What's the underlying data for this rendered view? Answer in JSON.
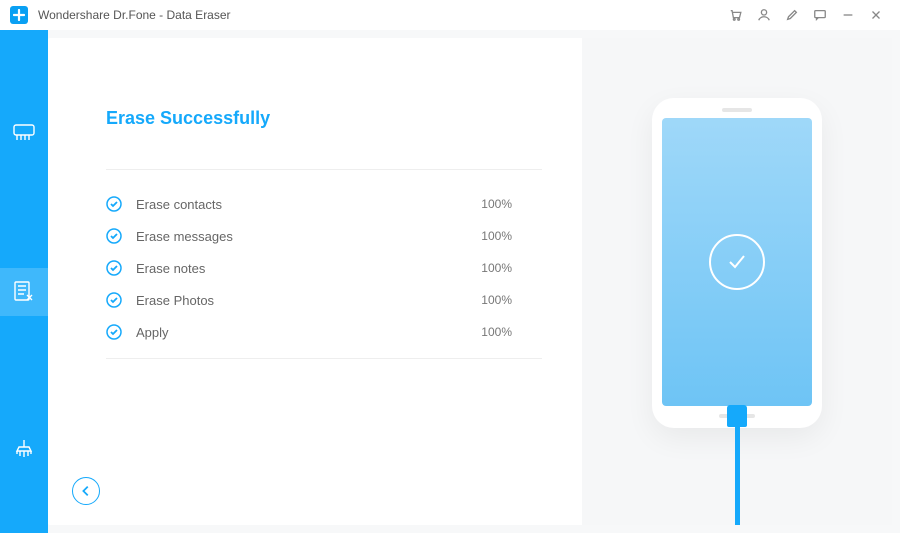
{
  "window": {
    "title": "Wondershare Dr.Fone - Data Eraser"
  },
  "heading": "Erase Successfully",
  "tasks": [
    {
      "label": "Erase contacts",
      "pct": "100%"
    },
    {
      "label": "Erase messages",
      "pct": "100%"
    },
    {
      "label": "Erase notes",
      "pct": "100%"
    },
    {
      "label": "Erase Photos",
      "pct": "100%"
    },
    {
      "label": "Apply",
      "pct": "100%"
    }
  ]
}
